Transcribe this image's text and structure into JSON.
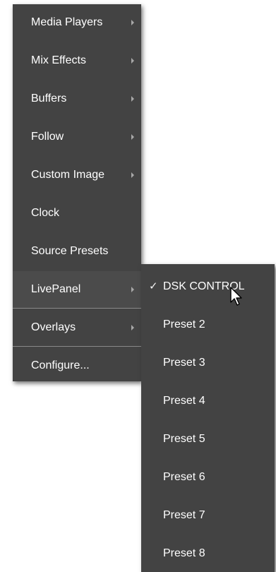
{
  "main_menu": {
    "items": [
      {
        "label": "Media Players",
        "submenu": true
      },
      {
        "label": "Mix Effects",
        "submenu": true
      },
      {
        "label": "Buffers",
        "submenu": true
      },
      {
        "label": "Follow",
        "submenu": true
      },
      {
        "label": "Custom Image",
        "submenu": true
      },
      {
        "label": "Clock",
        "submenu": false
      },
      {
        "label": "Source Presets",
        "submenu": false
      },
      {
        "label": "LivePanel",
        "submenu": true
      },
      {
        "label": "Overlays",
        "submenu": true
      },
      {
        "label": "Configure...",
        "submenu": false
      }
    ]
  },
  "livepanel_submenu": {
    "items": [
      {
        "label": "DSK CONTROL",
        "checked": true
      },
      {
        "label": "Preset 2",
        "checked": false
      },
      {
        "label": "Preset 3",
        "checked": false
      },
      {
        "label": "Preset 4",
        "checked": false
      },
      {
        "label": "Preset 5",
        "checked": false
      },
      {
        "label": "Preset 6",
        "checked": false
      },
      {
        "label": "Preset 7",
        "checked": false
      },
      {
        "label": "Preset 8",
        "checked": false
      }
    ]
  },
  "check_glyph": "✓",
  "icons": {
    "submenu_arrow": "chevron-right-icon",
    "check": "checkmark-icon",
    "cursor": "mouse-pointer-icon"
  },
  "colors": {
    "menu_bg": "#434343",
    "text": "#ffffff",
    "separator": "#8a8a8a",
    "arrow": "#a8a8a8"
  }
}
